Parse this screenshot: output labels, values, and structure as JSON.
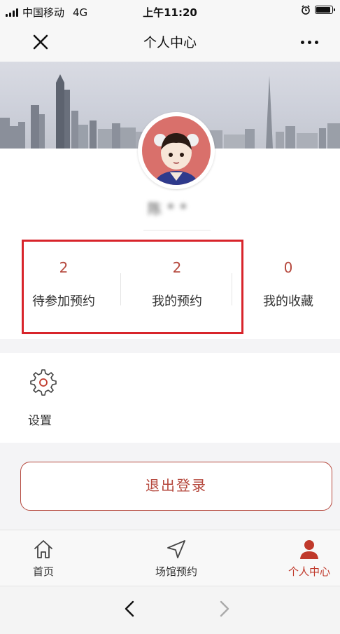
{
  "status_bar": {
    "carrier": "中国移动",
    "network": "4G",
    "time": "上午11:20"
  },
  "nav": {
    "title": "个人中心",
    "close_icon": "close-icon",
    "more_icon": "more-icon"
  },
  "profile": {
    "username": "陈**",
    "avatar": "cartoon-avatar"
  },
  "stats": [
    {
      "value": "2",
      "label": "待参加预约"
    },
    {
      "value": "2",
      "label": "我的预约"
    },
    {
      "value": "0",
      "label": "我的收藏"
    }
  ],
  "settings": {
    "label": "设置",
    "icon": "gear-icon"
  },
  "logout": {
    "label": "退出登录"
  },
  "tabbar": {
    "items": [
      {
        "label": "首页",
        "icon": "home-icon"
      },
      {
        "label": "场馆预约",
        "icon": "navigation-icon"
      },
      {
        "label": "个人中心",
        "icon": "user-icon"
      }
    ],
    "active_index": 2
  },
  "colors": {
    "accent": "#b5473c",
    "highlight_border": "#d8242b",
    "avatar_bg": "#d9706b"
  }
}
